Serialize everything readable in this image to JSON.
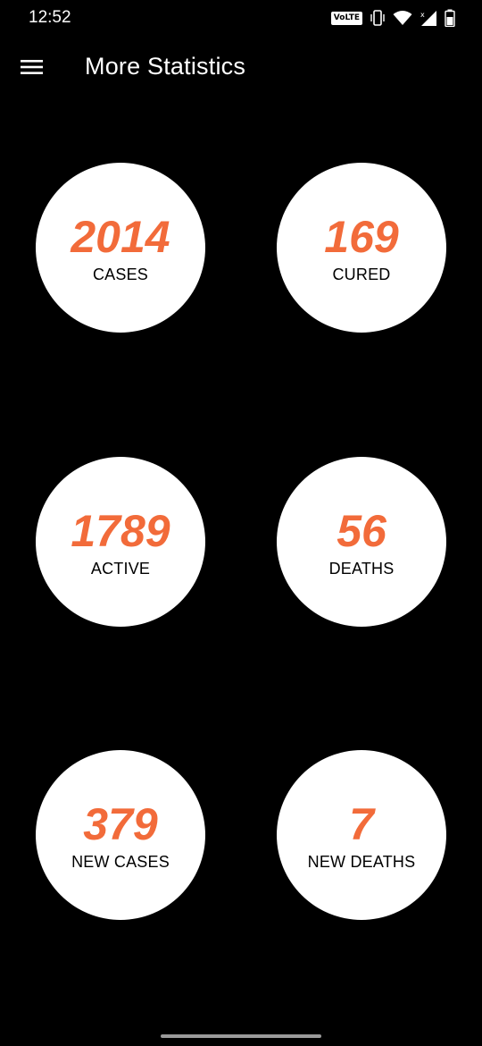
{
  "status_bar": {
    "time": "12:52",
    "volte": "VoLTE",
    "icons": [
      "vibrate-icon",
      "wifi-icon",
      "cell-signal-icon",
      "battery-icon"
    ]
  },
  "app_bar": {
    "menu_icon": "hamburger-menu-icon",
    "title": "More Statistics"
  },
  "colors": {
    "background": "#000000",
    "circle": "#ffffff",
    "value": "#f26b3a",
    "label": "#000000"
  },
  "stats": [
    {
      "value": "2014",
      "label": "CASES"
    },
    {
      "value": "169",
      "label": "CURED"
    },
    {
      "value": "1789",
      "label": "ACTIVE"
    },
    {
      "value": "56",
      "label": "DEATHS"
    },
    {
      "value": "379",
      "label": "NEW CASES"
    },
    {
      "value": "7",
      "label": "NEW DEATHS"
    }
  ]
}
